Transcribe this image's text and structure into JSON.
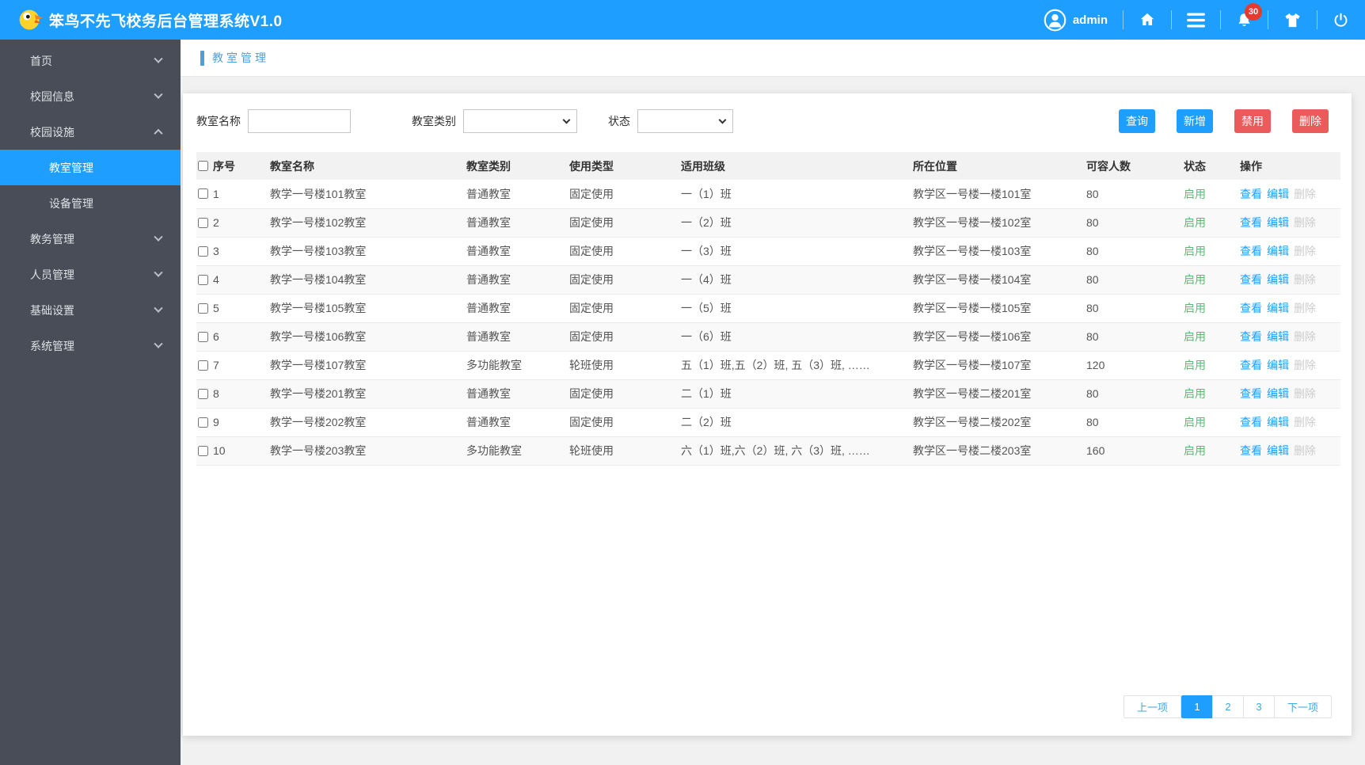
{
  "header": {
    "title": "笨鸟不先飞校务后台管理系统V1.0",
    "user": "admin",
    "notification_count": "30"
  },
  "sidebar": {
    "items": [
      {
        "label": "首页",
        "level": 1,
        "chevron": "down",
        "active": false
      },
      {
        "label": "校园信息",
        "level": 1,
        "chevron": "down",
        "active": false
      },
      {
        "label": "校园设施",
        "level": 1,
        "chevron": "up",
        "active": false
      },
      {
        "label": "教室管理",
        "level": 2,
        "chevron": "",
        "active": true
      },
      {
        "label": "设备管理",
        "level": 2,
        "chevron": "",
        "active": false
      },
      {
        "label": "教务管理",
        "level": 1,
        "chevron": "down",
        "active": false
      },
      {
        "label": "人员管理",
        "level": 1,
        "chevron": "down",
        "active": false
      },
      {
        "label": "基础设置",
        "level": 1,
        "chevron": "down",
        "active": false
      },
      {
        "label": "系统管理",
        "level": 1,
        "chevron": "down",
        "active": false
      }
    ]
  },
  "breadcrumb": {
    "title": "教室管理"
  },
  "filters": {
    "name_label": "教室名称",
    "name_value": "",
    "category_label": "教室类别",
    "category_value": "",
    "status_label": "状态",
    "status_value": ""
  },
  "toolbar": {
    "query_label": "查询",
    "add_label": "新增",
    "disable_label": "禁用",
    "delete_label": "删除"
  },
  "table": {
    "columns": [
      "序号",
      "教室名称",
      "教室类别",
      "使用类型",
      "适用班级",
      "所在位置",
      "可容人数",
      "状态",
      "操作"
    ],
    "action_labels": {
      "view": "查看",
      "edit": "编辑",
      "delete": "删除"
    },
    "rows": [
      {
        "no": "1",
        "name": "教学一号楼101教室",
        "category": "普通教室",
        "use_type": "固定使用",
        "classes": "一（1）班",
        "location": "教学区一号楼一楼101室",
        "capacity": "80",
        "status": "启用"
      },
      {
        "no": "2",
        "name": "教学一号楼102教室",
        "category": "普通教室",
        "use_type": "固定使用",
        "classes": "一（2）班",
        "location": "教学区一号楼一楼102室",
        "capacity": "80",
        "status": "启用"
      },
      {
        "no": "3",
        "name": "教学一号楼103教室",
        "category": "普通教室",
        "use_type": "固定使用",
        "classes": "一（3）班",
        "location": "教学区一号楼一楼103室",
        "capacity": "80",
        "status": "启用"
      },
      {
        "no": "4",
        "name": "教学一号楼104教室",
        "category": "普通教室",
        "use_type": "固定使用",
        "classes": "一（4）班",
        "location": "教学区一号楼一楼104室",
        "capacity": "80",
        "status": "启用"
      },
      {
        "no": "5",
        "name": "教学一号楼105教室",
        "category": "普通教室",
        "use_type": "固定使用",
        "classes": "一（5）班",
        "location": "教学区一号楼一楼105室",
        "capacity": "80",
        "status": "启用"
      },
      {
        "no": "6",
        "name": "教学一号楼106教室",
        "category": "普通教室",
        "use_type": "固定使用",
        "classes": "一（6）班",
        "location": "教学区一号楼一楼106室",
        "capacity": "80",
        "status": "启用"
      },
      {
        "no": "7",
        "name": "教学一号楼107教室",
        "category": "多功能教室",
        "use_type": "轮班使用",
        "classes": "五（1）班,五（2）班, 五（3）班, ……",
        "location": "教学区一号楼一楼107室",
        "capacity": "120",
        "status": "启用"
      },
      {
        "no": "8",
        "name": "教学一号楼201教室",
        "category": "普通教室",
        "use_type": "固定使用",
        "classes": "二（1）班",
        "location": "教学区一号楼二楼201室",
        "capacity": "80",
        "status": "启用"
      },
      {
        "no": "9",
        "name": "教学一号楼202教室",
        "category": "普通教室",
        "use_type": "固定使用",
        "classes": "二（2）班",
        "location": "教学区一号楼二楼202室",
        "capacity": "80",
        "status": "启用"
      },
      {
        "no": "10",
        "name": "教学一号楼203教室",
        "category": "多功能教室",
        "use_type": "轮班使用",
        "classes": "六（1）班,六（2）班, 六（3）班, ……",
        "location": "教学区一号楼二楼203室",
        "capacity": "160",
        "status": "启用"
      }
    ]
  },
  "pagination": {
    "prev_label": "上一项",
    "pages": [
      "1",
      "2",
      "3"
    ],
    "active_page": "1",
    "next_label": "下一项"
  },
  "colors": {
    "primary": "#1E9FFF",
    "danger": "#EC5B5B",
    "success": "#5FB878",
    "sidebar_bg": "#484D57",
    "badge": "#E53A30",
    "breadcrumb": "#4D9FDB"
  }
}
